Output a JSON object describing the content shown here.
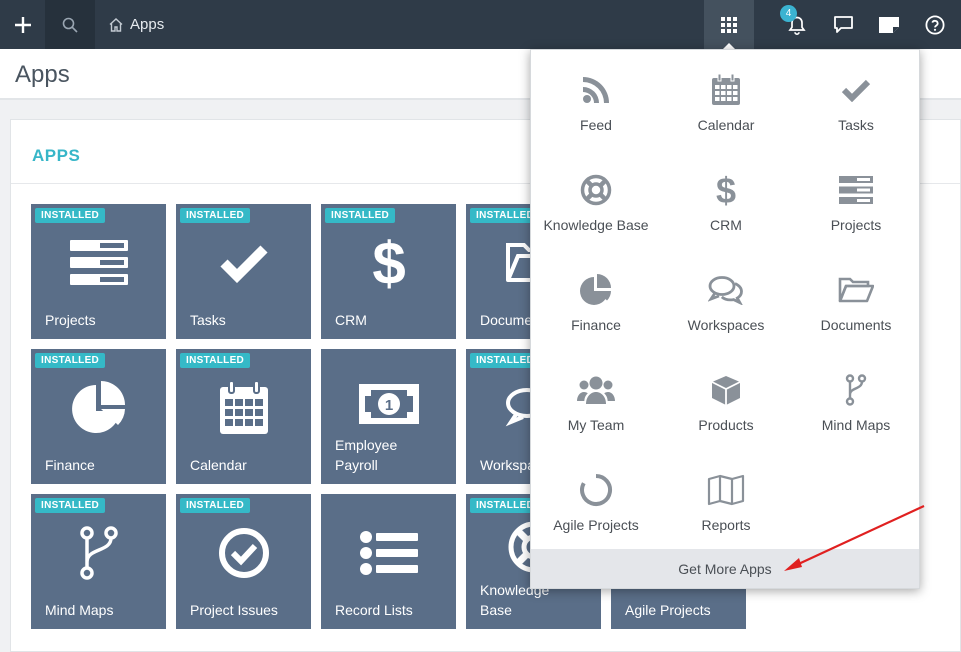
{
  "topbar": {
    "breadcrumb": "Apps",
    "notification_count": "4"
  },
  "page": {
    "title": "Apps"
  },
  "panel": {
    "title": "APPS",
    "installed_label": "INSTALLED",
    "tiles": [
      {
        "label": "Projects",
        "icon": "projects-icon",
        "installed": true
      },
      {
        "label": "Tasks",
        "icon": "check-icon",
        "installed": true
      },
      {
        "label": "CRM",
        "icon": "dollar-icon",
        "installed": true
      },
      {
        "label": "Docume",
        "icon": "folder-icon",
        "installed": true
      },
      {
        "label": "Finance",
        "icon": "pie-chart-icon",
        "installed": true
      },
      {
        "label": "Calendar",
        "icon": "calendar-icon",
        "installed": true
      },
      {
        "label": "Employee\nPayroll",
        "icon": "money-icon",
        "installed": false
      },
      {
        "label": "Workspa",
        "icon": "chat-icon",
        "installed": true
      },
      {
        "label": "Mind Maps",
        "icon": "branch-icon",
        "installed": true
      },
      {
        "label": "Project Issues",
        "icon": "check-circle-icon",
        "installed": true
      },
      {
        "label": "Record Lists",
        "icon": "list-icon",
        "installed": false
      },
      {
        "label": "Knowledge\nBase",
        "icon": "lifebuoy-icon",
        "installed": true
      },
      {
        "label": "Agile Projects",
        "icon": "ring-icon",
        "installed": false
      }
    ]
  },
  "dropdown": {
    "items": [
      {
        "label": "Feed",
        "icon": "rss-icon"
      },
      {
        "label": "Calendar",
        "icon": "calendar-icon"
      },
      {
        "label": "Tasks",
        "icon": "check-icon"
      },
      {
        "label": "Knowledge Base",
        "icon": "lifebuoy-icon"
      },
      {
        "label": "CRM",
        "icon": "dollar-icon"
      },
      {
        "label": "Projects",
        "icon": "projects-icon"
      },
      {
        "label": "Finance",
        "icon": "pie-chart-icon"
      },
      {
        "label": "Workspaces",
        "icon": "chat-icon"
      },
      {
        "label": "Documents",
        "icon": "folder-icon"
      },
      {
        "label": "My Team",
        "icon": "team-icon"
      },
      {
        "label": "Products",
        "icon": "box-icon"
      },
      {
        "label": "Mind Maps",
        "icon": "branch-icon"
      },
      {
        "label": "Agile Projects",
        "icon": "ring-icon"
      },
      {
        "label": "Reports",
        "icon": "map-icon"
      }
    ],
    "footer": "Get More Apps"
  },
  "colors": {
    "topbar": "#2f3b48",
    "accent": "#37b6c8",
    "tile": "#5a6e88",
    "annotation_arrow": "#e02020"
  }
}
